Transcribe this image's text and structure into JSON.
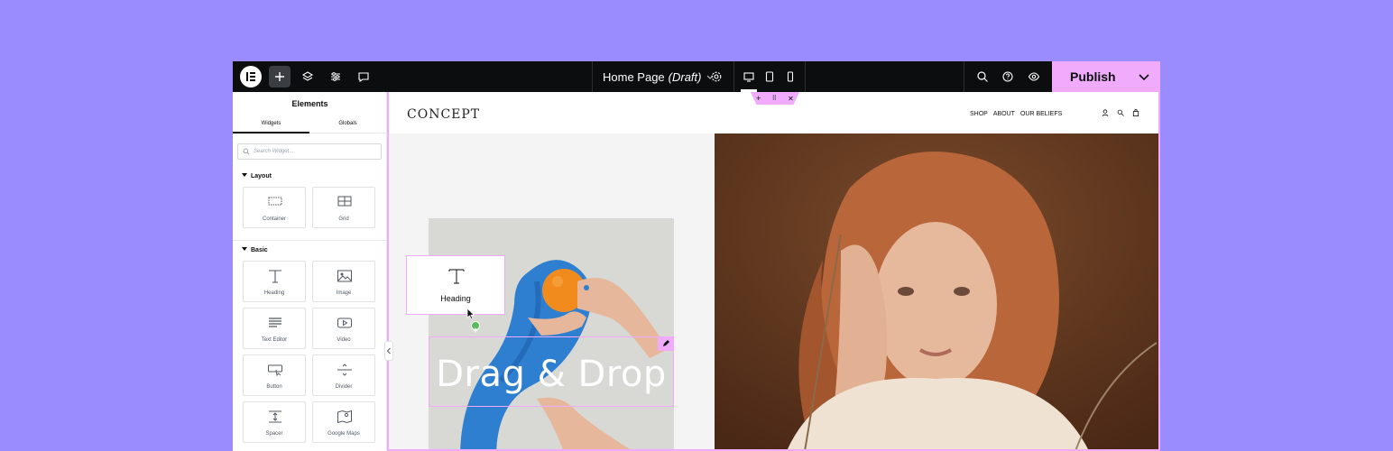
{
  "topbar": {
    "page_name": "Home Page",
    "page_status": "(Draft)",
    "publish_label": "Publish"
  },
  "panel": {
    "title": "Elements",
    "tabs": [
      "Widgets",
      "Globals"
    ],
    "search_placeholder": "Search Widget...",
    "categories": {
      "layout": {
        "label": "Layout",
        "items": [
          "Container",
          "Grid"
        ]
      },
      "basic": {
        "label": "Basic",
        "items": [
          "Heading",
          "Image",
          "Text Editor",
          "Video",
          "Button",
          "Divider",
          "Spacer",
          "Google Maps"
        ]
      }
    }
  },
  "site": {
    "brand": "CONCEPT",
    "nav": [
      "SHOP",
      "ABOUT",
      "OUR BELIEFS"
    ],
    "heading": "Drag & Drop"
  },
  "drag_widget": {
    "label": "Heading"
  },
  "colors": {
    "accent": "#f0abfc",
    "topbar": "#0c0d0e",
    "background": "#9a8cff"
  }
}
